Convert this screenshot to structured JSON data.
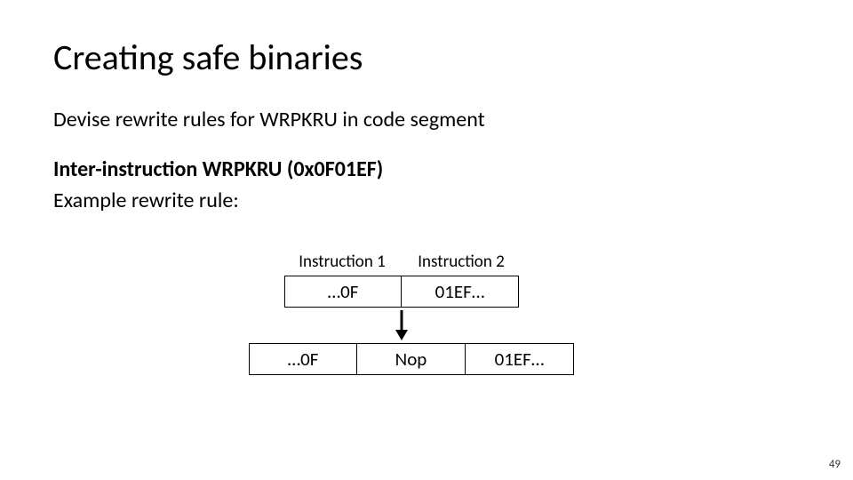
{
  "title": "Creating safe binaries",
  "line1": "Devise rewrite rules for WRPKRU in code segment",
  "line2_strong": "Inter-instruction WRPKRU (0x0F01EF)",
  "line3": "Example rewrite rule:",
  "diagram": {
    "label1": "Instruction 1",
    "label2": "Instruction 2",
    "row1": {
      "c1": "…0F",
      "c2": "01EF…"
    },
    "row2": {
      "c1": "…0F",
      "c2": "Nop",
      "c3": "01EF…"
    }
  },
  "page_number": "49"
}
